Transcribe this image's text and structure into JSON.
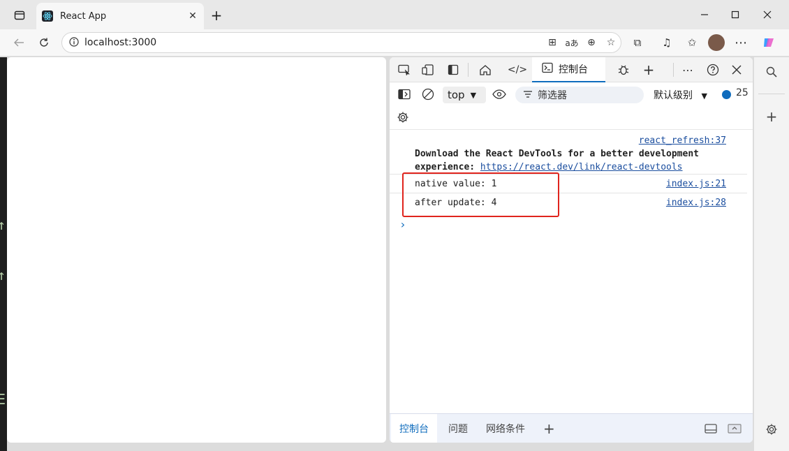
{
  "browser": {
    "tab_title": "React App",
    "url": "localhost:3000",
    "new_tab_icon": "plus-icon",
    "close_icon": "close-icon"
  },
  "devtools": {
    "console_tab_label": "控制台",
    "context": "top",
    "filter_placeholder": "筛选器",
    "level_label": "默认级别",
    "issue_count": "25",
    "messages": [
      {
        "source": "react_refresh:37",
        "text_line1": "Download the React DevTools for a better development",
        "text_line2_prefix": "experience: ",
        "link": "https://react.dev/link/react-devtools"
      },
      {
        "text": "native value: 1",
        "source": "index.js:21"
      },
      {
        "text": "after update: 4",
        "source": "index.js:28"
      }
    ],
    "drawer_tabs": [
      "控制台",
      "问题",
      "网络条件"
    ]
  },
  "colors": {
    "accent": "#0f6cbd",
    "highlight": "#e0241d",
    "link": "#1a4d9e"
  }
}
